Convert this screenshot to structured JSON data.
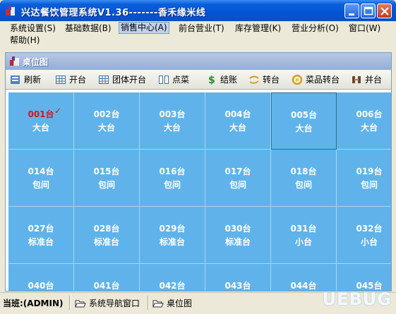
{
  "window": {
    "title": "兴达餐饮管理系统V1.36-------香禾缘米线"
  },
  "menu": [
    {
      "label": "系统设置(S)"
    },
    {
      "label": "基础数据(B)"
    },
    {
      "label": "销售中心(A)"
    },
    {
      "label": "前台营业(T)"
    },
    {
      "label": "库存管理(K)"
    },
    {
      "label": "营业分析(O)"
    },
    {
      "label": "窗口(W)"
    },
    {
      "label": "帮助(H)"
    }
  ],
  "inner_window": {
    "title": "桌位图"
  },
  "toolbar": [
    {
      "label": "刷新",
      "icon": "refresh-icon"
    },
    {
      "label": "开台",
      "icon": "grid-icon"
    },
    {
      "label": "团体开台",
      "icon": "grid-icon"
    },
    {
      "label": "点菜",
      "icon": "columns-icon"
    },
    {
      "label": "结账",
      "icon": "dollar-icon"
    },
    {
      "label": "转台",
      "icon": "transfer-icon"
    },
    {
      "label": "菜品转台",
      "icon": "swap-icon"
    },
    {
      "label": "并台",
      "icon": "merge-icon"
    }
  ],
  "tables": [
    {
      "num": "001台",
      "type": "大台",
      "occupied": true
    },
    {
      "num": "002台",
      "type": "大台"
    },
    {
      "num": "003台",
      "type": "大台"
    },
    {
      "num": "004台",
      "type": "大台"
    },
    {
      "num": "005台",
      "type": "大台"
    },
    {
      "num": "006台",
      "type": "大台"
    },
    {
      "num": "014台",
      "type": "包间"
    },
    {
      "num": "015台",
      "type": "包间"
    },
    {
      "num": "016台",
      "type": "包间"
    },
    {
      "num": "017台",
      "type": "包间"
    },
    {
      "num": "018台",
      "type": "包间"
    },
    {
      "num": "019台",
      "type": "包间"
    },
    {
      "num": "027台",
      "type": "标准台"
    },
    {
      "num": "028台",
      "type": "标准台"
    },
    {
      "num": "029台",
      "type": "标准台"
    },
    {
      "num": "030台",
      "type": "标准台"
    },
    {
      "num": "031台",
      "type": "小台"
    },
    {
      "num": "032台",
      "type": "小台"
    },
    {
      "num": "040台",
      "type": ""
    },
    {
      "num": "041台",
      "type": ""
    },
    {
      "num": "042台",
      "type": ""
    },
    {
      "num": "043台",
      "type": ""
    },
    {
      "num": "044台",
      "type": ""
    },
    {
      "num": "045台",
      "type": ""
    }
  ],
  "check_mark": "✓",
  "status": {
    "user": "当班:(ADMIN)",
    "tasks": [
      {
        "label": "系统导航窗口"
      },
      {
        "label": "桌位图"
      }
    ]
  },
  "watermark": "UEBUG",
  "colors": {
    "title_bar": "#0554d6",
    "table_cell": "#5fb3ea",
    "occupied_text": "#d8141c"
  }
}
